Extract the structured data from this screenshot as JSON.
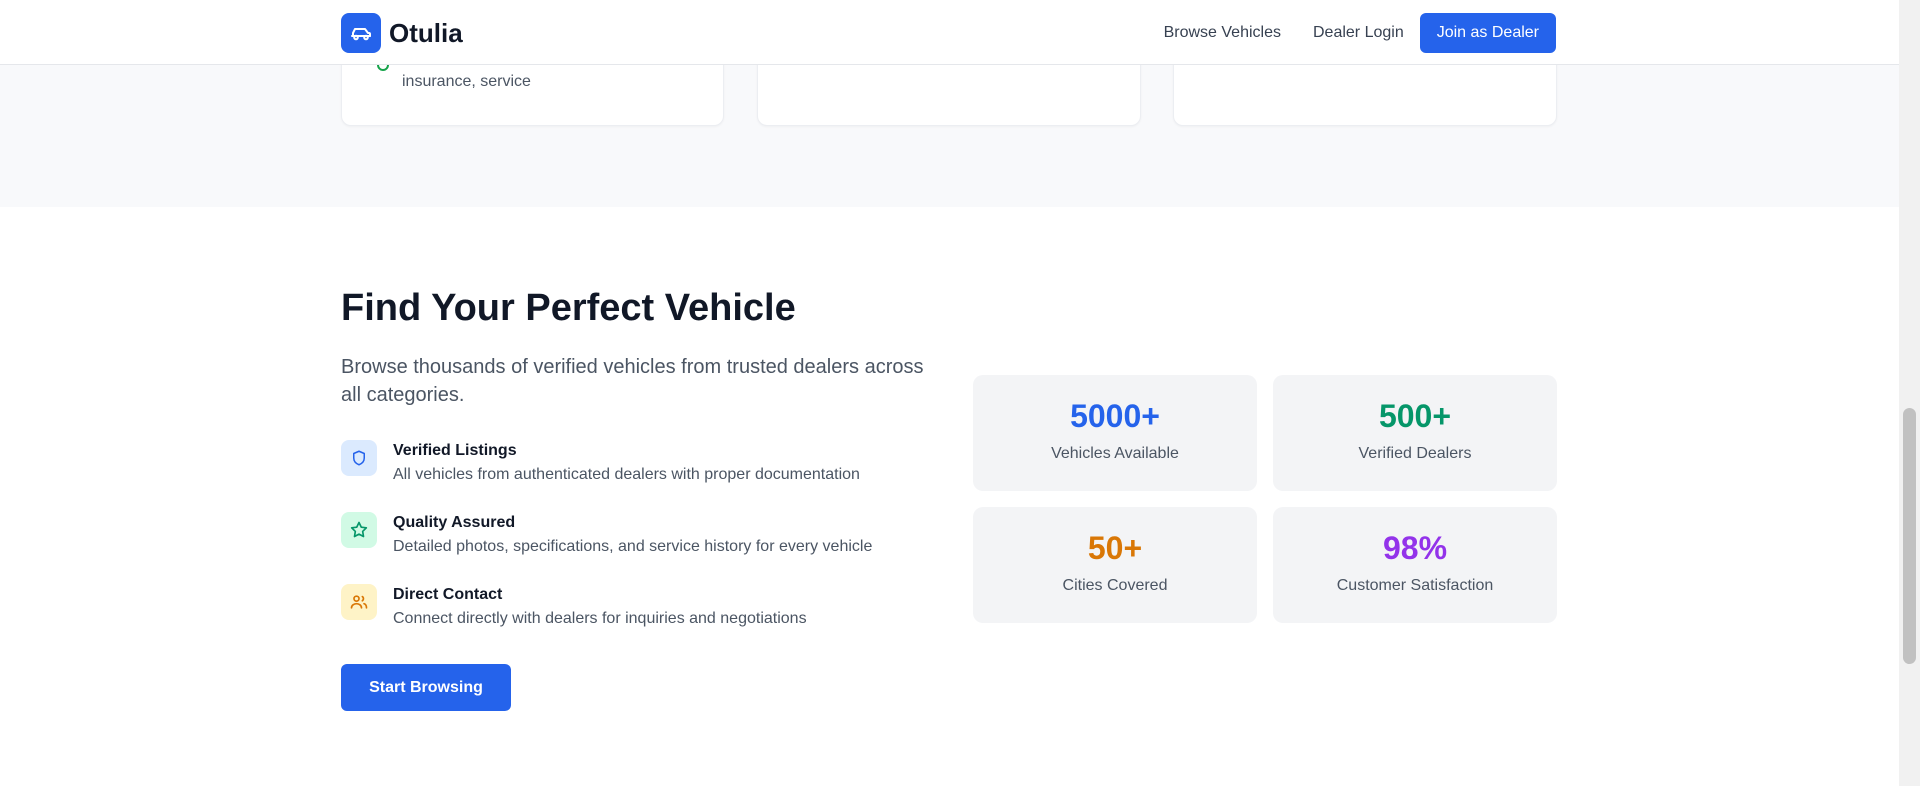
{
  "header": {
    "brand": "Otulia",
    "nav": [
      "Browse Vehicles",
      "Dealer Login"
    ],
    "cta": "Join as Dealer"
  },
  "top_cards": {
    "card1_text": "insurance, service"
  },
  "hero": {
    "title": "Find Your Perfect Vehicle",
    "subtitle": "Browse thousands of verified vehicles from trusted dealers across all categories.",
    "features": [
      {
        "icon": "shield-icon",
        "title": "Verified Listings",
        "desc": "All vehicles from authenticated dealers with proper documentation"
      },
      {
        "icon": "star-icon",
        "title": "Quality Assured",
        "desc": "Detailed photos, specifications, and service history for every vehicle"
      },
      {
        "icon": "users-icon",
        "title": "Direct Contact",
        "desc": "Connect directly with dealers for inquiries and negotiations"
      }
    ],
    "button": "Start Browsing"
  },
  "stats": [
    {
      "value": "5000+",
      "label": "Vehicles Available",
      "color": "#2563eb"
    },
    {
      "value": "500+",
      "label": "Verified Dealers",
      "color": "#059669"
    },
    {
      "value": "50+",
      "label": "Cities Covered",
      "color": "#d97706"
    },
    {
      "value": "98%",
      "label": "Customer Satisfaction",
      "color": "#9333ea"
    }
  ],
  "colors": {
    "primary": "#2563eb",
    "band_bg": "#f8f9fb",
    "stat_bg": "#f3f4f6"
  }
}
